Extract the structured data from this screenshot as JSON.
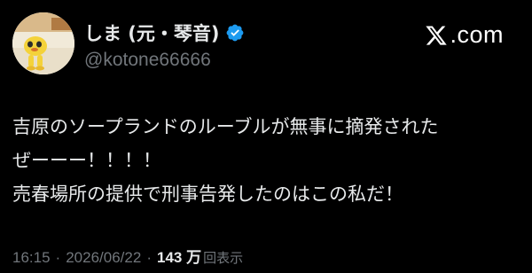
{
  "author": {
    "display_name": "しま (元・琴音)",
    "handle": "@kotone66666",
    "verified": true,
    "avatar_icon": "yellow-cartoon-character-avatar"
  },
  "brand": {
    "icon": "x-logo-icon",
    "text": ".com"
  },
  "tweet": {
    "lines": [
      "吉原のソープランドのルーブルが無事に摘発された",
      "ぜーーー！！！！",
      "売春場所の提供で刑事告発したのはこの私だ！"
    ]
  },
  "meta": {
    "time": "16:15",
    "separator": "·",
    "date": "2026/06/22",
    "view_count": "143 万",
    "views_label": "回表示"
  },
  "colors": {
    "background": "#000000",
    "text_primary": "#e7e9ea",
    "text_secondary": "#71767b",
    "verified_blue": "#1d9bf0"
  }
}
